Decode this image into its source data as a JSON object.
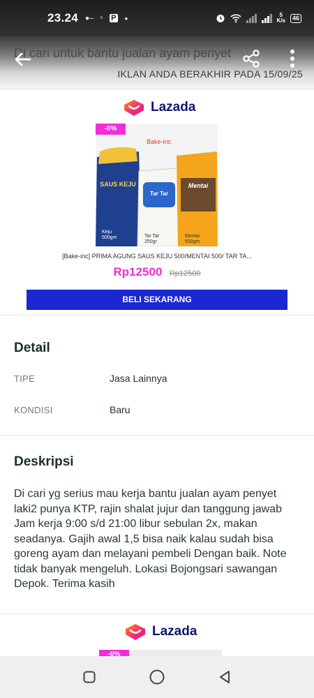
{
  "status_bar": {
    "time": "23.24",
    "net_speed_value": "5",
    "net_speed_unit": "K/s",
    "battery": "46"
  },
  "header": {
    "title": "Di cari untuk bantu jualan ayam penyet",
    "expiry": "IKLAN ANDA BERAKHIR PADA 15/09/25"
  },
  "ad": {
    "brand": "Lazada",
    "discount": "-0%",
    "image_brand_label": "Bake-inc",
    "package_labels": [
      "SAUS KEJU",
      "Tar Tar",
      "Mentai"
    ],
    "package_captions": [
      "Keju 500gm",
      "Tar Tar 250gr",
      "Mentai 500gm"
    ],
    "product_name": "[Bake-inc] PRIMA AGUNG SAUS KEJU 500/MENTAI 500/ TAR TA...",
    "price": "Rp12500",
    "old_price": "Rp12500",
    "buy_label": "BELI SEKARANG"
  },
  "detail": {
    "title": "Detail",
    "rows": [
      {
        "key": "TIPE",
        "value": "Jasa Lainnya"
      },
      {
        "key": "KONDISI",
        "value": "Baru"
      }
    ]
  },
  "description": {
    "title": "Deskripsi",
    "text": "Di cari yg serius mau kerja bantu jualan ayam penyet laki2 punya KTP, rajin shalat jujur dan tanggung jawab Jam kerja 9:00 s/d 21:00 libur sebulan 2x, makan seadanya. Gajih awal 1,5 bisa naik kalau sudah bisa goreng ayam dan melayani pembeli Dengan baik. Note tidak banyak mengeluh. Lokasi Bojongsari sawangan Depok. Terima kasih"
  },
  "ad2": {
    "brand": "Lazada",
    "discount": "-0%"
  },
  "colors": {
    "lazada_navy": "#0f146d",
    "discount_pink": "#f22cd6",
    "buy_blue": "#1a27d2"
  },
  "icons": [
    "back-arrow-icon",
    "share-icon",
    "more-vert-icon",
    "lazada-heart-icon",
    "recents-icon",
    "home-icon",
    "back-triangle-icon"
  ]
}
